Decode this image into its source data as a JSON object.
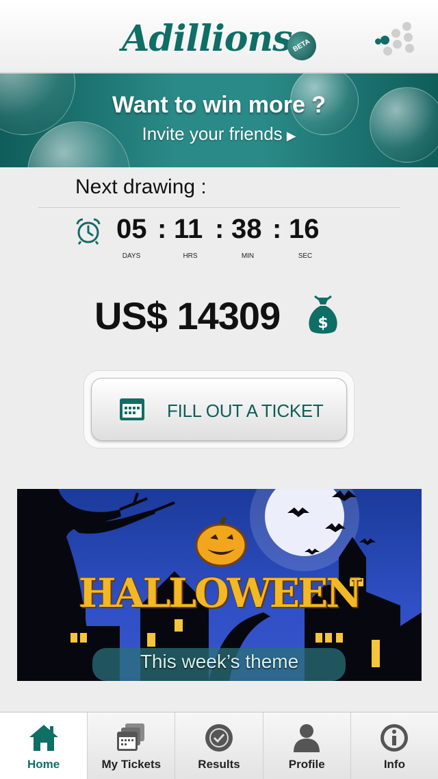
{
  "header": {
    "logo_text": "Adillions",
    "badge": "BETA",
    "menu_icon": "dots-grid-icon"
  },
  "banner": {
    "title": "Want to win more ?",
    "subtitle": "Invite your friends",
    "arrow": "▶"
  },
  "drawing": {
    "label": "Next drawing :",
    "countdown": {
      "days": "05",
      "hours": "11",
      "minutes": "38",
      "seconds": "16",
      "separator": ":",
      "days_label": "DAYS",
      "hours_label": "HRS",
      "minutes_label": "MIN",
      "seconds_label": "SEC"
    },
    "icon": "alarm-clock-icon"
  },
  "jackpot": {
    "amount": "US$ 14309",
    "icon": "money-bag-icon"
  },
  "action": {
    "label": "FILL OUT A TICKET",
    "icon": "calendar-icon"
  },
  "theme": {
    "title": "HALLOWEEN",
    "subtitle": "This week’s theme"
  },
  "tabs": [
    {
      "label": "Home",
      "icon": "home-icon",
      "active": true
    },
    {
      "label": "My Tickets",
      "icon": "tickets-icon",
      "active": false
    },
    {
      "label": "Results",
      "icon": "results-check-icon",
      "active": false
    },
    {
      "label": "Profile",
      "icon": "profile-icon",
      "active": false
    },
    {
      "label": "Info",
      "icon": "info-icon",
      "active": false
    }
  ],
  "colors": {
    "brand": "#0f6e66",
    "banner": "#2a8a87",
    "background": "#eeeded"
  }
}
